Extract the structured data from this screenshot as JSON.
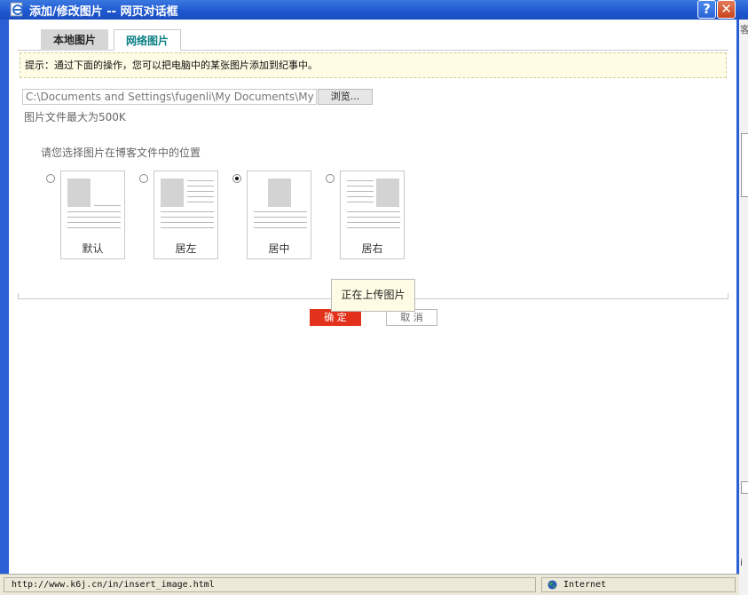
{
  "window": {
    "title": "添加/修改图片 -- 网页对话框",
    "help_glyph": "?",
    "close_glyph": "✕"
  },
  "tabs": [
    {
      "label": "本地图片"
    },
    {
      "label": "网络图片"
    }
  ],
  "tip": "提示：通过下面的操作，您可以把电脑中的某张图片添加到纪事中。",
  "file": {
    "path_value": "C:\\Documents and Settings\\fugenli\\My Documents\\My Pictures",
    "browse_label": "浏览...",
    "size_note": "图片文件最大为500K"
  },
  "position": {
    "label": "请您选择图片在博客文件中的位置",
    "options": [
      {
        "label": "默认",
        "selected": false
      },
      {
        "label": "居左",
        "selected": false
      },
      {
        "label": "居中",
        "selected": true
      },
      {
        "label": "居右",
        "selected": false
      }
    ]
  },
  "tooltip": "正在上传图片",
  "buttons": {
    "ok": "确 定",
    "cancel": "取 消"
  },
  "status": {
    "url": "http://www.k6j.cn/in/insert_image.html",
    "zone": "Internet"
  },
  "background": {
    "edge_text_top": "客",
    "edge_text_bottom": "i"
  },
  "colors": {
    "ok_button": "#e3321b",
    "active_tab_text": "#0b7f84",
    "tip_background": "#fefce4"
  }
}
